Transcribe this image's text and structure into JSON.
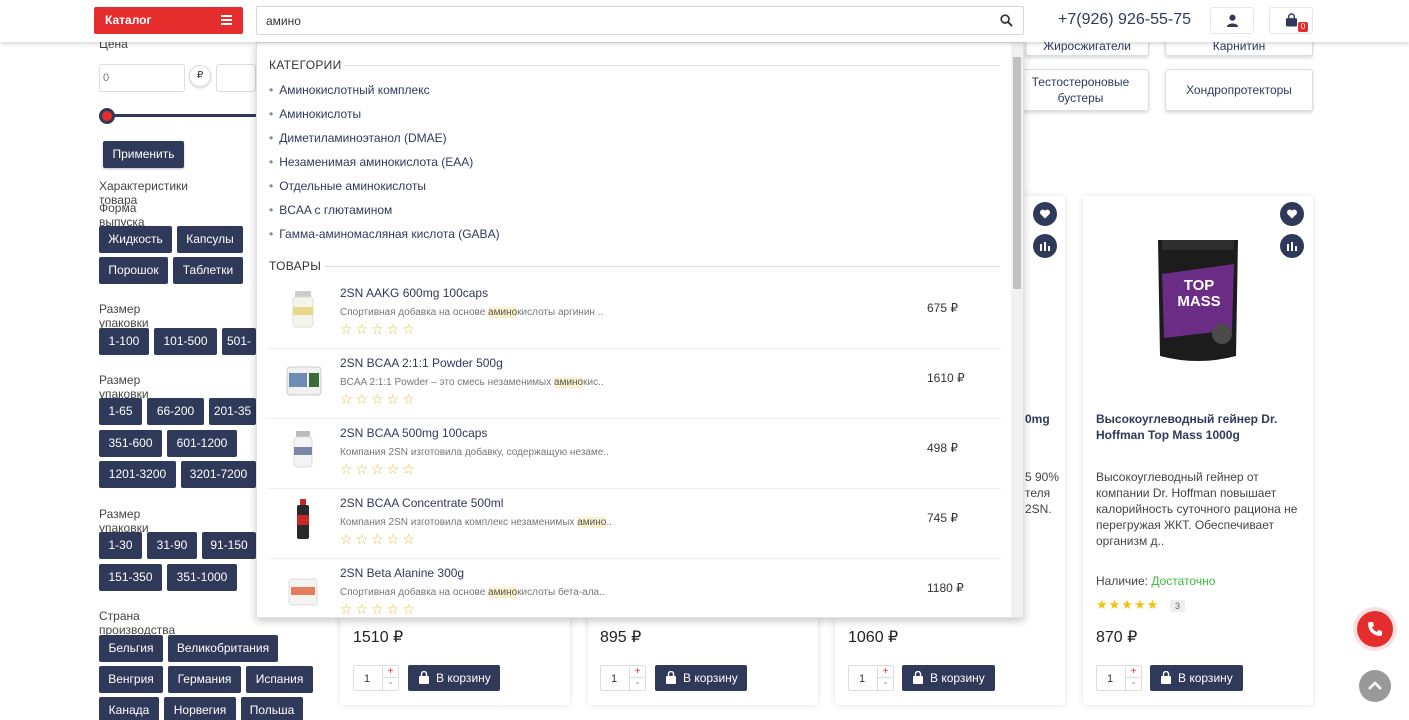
{
  "header": {
    "catalog_label": "Каталог",
    "search_value": "амино",
    "phone": "+7(926) 926-55-75",
    "cart_count": "0"
  },
  "filters": {
    "price_label": "Цена",
    "price_from": "0",
    "currency": "₽",
    "apply_label": "Применить",
    "characteristics_label": "Характеристики товара",
    "form_label": "Форма выпуска",
    "form_options": [
      "Жидкость",
      "Капсулы",
      "Порошок",
      "Таблетки"
    ],
    "pack_ml_label": "Размер упаковки ml.",
    "pack_ml_options": [
      "1-100",
      "101-500",
      "501-"
    ],
    "pack_g_label": "Размер упаковки гр.",
    "pack_g_options": [
      "1-65",
      "66-200",
      "201-35",
      "351-600",
      "601-1200",
      "1201-3200",
      "3201-7200"
    ],
    "pack_pcs_label": "Размер упаковки шт.",
    "pack_pcs_options": [
      "1-30",
      "31-90",
      "91-150",
      "151-350",
      "351-1000"
    ],
    "country_label": "Страна производства",
    "country_options": [
      "Бельгия",
      "Великобритания",
      "Венгрия",
      "Германия",
      "Испания",
      "Канада",
      "Норвегия",
      "Польша"
    ]
  },
  "category_tiles": [
    "Жиросжигатели",
    "Карнитин",
    "Тестостероновые бустеры",
    "Хондропротекторы"
  ],
  "products": {
    "card3_title_fragment": "0mg",
    "card3_desc_fragment": [
      "5 90%",
      "теля",
      "2SN."
    ],
    "card4": {
      "title": "Высокоуглеводный гейнер Dr. Hoffman Top Mass 1000g",
      "desc": "Высокоуглеводный гейнер от компании Dr. Hoffman повышает калорийность суточного рациона не перегружая ЖКТ. Обеспечивает организм д..",
      "stock_label": "Наличие:",
      "stock_value": "Достаточно",
      "stars": "★★★★★",
      "reviews": "3",
      "package_text": "TOP MASS"
    },
    "prices": [
      "1510 ₽",
      "895 ₽",
      "1060 ₽",
      "870 ₽"
    ],
    "qty": "1",
    "qty_plus": "+",
    "qty_minus": "-",
    "cart_label": "В корзину"
  },
  "dropdown": {
    "categories_title": "КАТЕГОРИИ",
    "categories": [
      "Аминокислотный комплекс",
      "Аминокислоты",
      "Диметиламиноэтанол (DMAE)",
      "Незаменимая аминокислота (EAA)",
      "Отдельные аминокислоты",
      "BCAA с глютамином",
      "Гамма-аминомасляная кислота (GABA)"
    ],
    "bullet": "•",
    "goods_title": "ТОВАРЫ",
    "stars_empty": "☆☆☆☆☆",
    "goods": [
      {
        "name": "2SN AAKG 600mg 100caps",
        "desc_before": "Спортивная добавка на основе ",
        "desc_mark": "амино",
        "desc_after": "кислоты аргинин ..",
        "price": "675 ₽"
      },
      {
        "name": "2SN BCAA 2:1:1 Powder 500g",
        "desc_before": "BCAA 2:1:1 Powder – это смесь незаменимых ",
        "desc_mark": "амино",
        "desc_after": "кис..",
        "price": "1610 ₽"
      },
      {
        "name": "2SN BCAA 500mg 100caps",
        "desc_before": "Компания 2SN изготовила добавку, содержащую незаме..",
        "desc_mark": "",
        "desc_after": "",
        "price": "498 ₽"
      },
      {
        "name": "2SN BCAA Concentrate 500ml",
        "desc_before": "Компания 2SN изготовила комплекс незаменимых ",
        "desc_mark": "амино",
        "desc_after": "..",
        "price": "745 ₽"
      },
      {
        "name": "2SN Beta Alanine 300g",
        "desc_before": "Спортивная добавка на основе ",
        "desc_mark": "амино",
        "desc_after": "кислоты бета-ала..",
        "price": "1180 ₽"
      }
    ]
  },
  "colors": {
    "brand_red": "#e52d2d",
    "navy": "#2f3a5a",
    "stock_green": "#3cba3c",
    "star_gold": "#f2c20c"
  }
}
